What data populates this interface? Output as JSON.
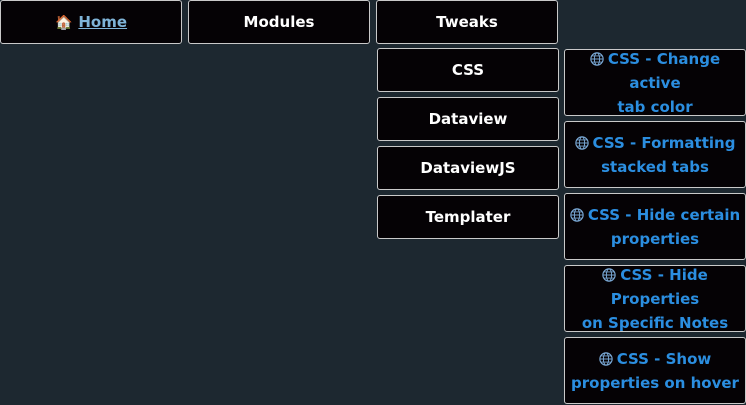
{
  "nav": {
    "home": {
      "icon": "house-icon",
      "label": "Home"
    },
    "modules": {
      "label": "Modules"
    },
    "tweaks": {
      "label": "Tweaks"
    }
  },
  "tweaks_menu": [
    {
      "label": "CSS"
    },
    {
      "label": "Dataview"
    },
    {
      "label": "DataviewJS"
    },
    {
      "label": "Templater"
    }
  ],
  "css_links": [
    {
      "icon": "globe-icon",
      "line1": "CSS - Change active",
      "line2": "tab color"
    },
    {
      "icon": "globe-icon",
      "line1": "CSS - Formatting",
      "line2": "stacked tabs"
    },
    {
      "icon": "globe-icon",
      "line1": "CSS - Hide certain",
      "line2": "properties"
    },
    {
      "icon": "globe-icon",
      "line1": "CSS - Hide Properties",
      "line2": "on Specific Notes"
    },
    {
      "icon": "globe-icon",
      "line1": "CSS - Show",
      "line2": "properties on hover"
    }
  ],
  "colors": {
    "background": "#1d2830",
    "button_bg": "#050205",
    "button_border": "#c9c9c9",
    "link_blue": "#2b8ee0",
    "home_link": "#7fb4d8"
  }
}
